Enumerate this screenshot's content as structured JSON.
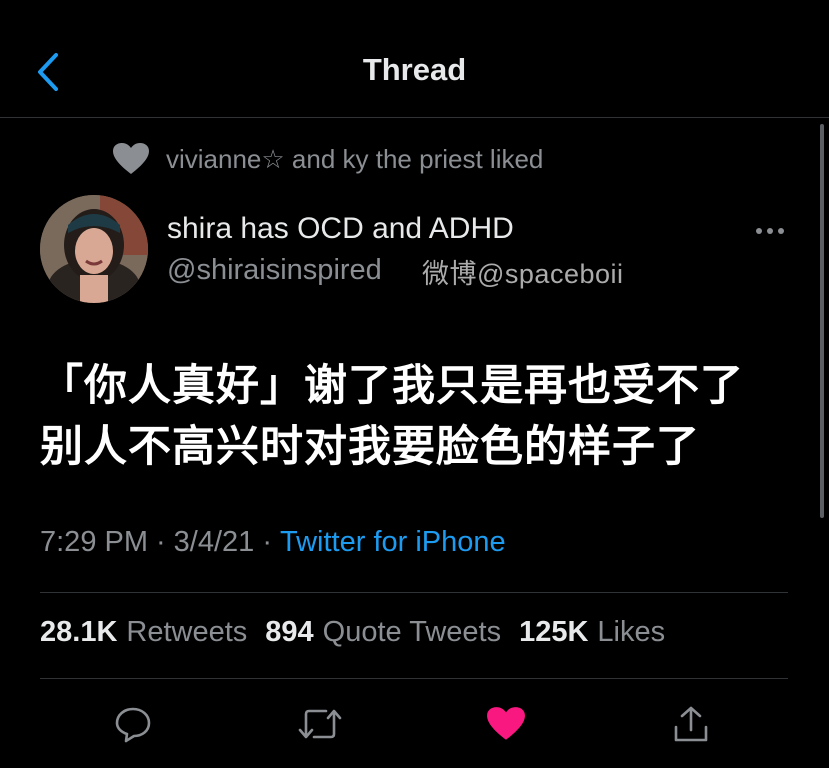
{
  "header": {
    "title": "Thread",
    "back_icon": "chevron-left-icon",
    "accent_color": "#1d9bf0"
  },
  "social_context": {
    "icon": "heart-icon",
    "text": "vivianne☆ and ky the priest liked"
  },
  "tweet": {
    "author": {
      "display_name": "shira has OCD and ADHD",
      "handle": "@shiraisinspired"
    },
    "watermark": "微博@spaceboii",
    "text_lines": [
      "「你人真好」谢了我只是再也受不了",
      "别人不高兴时对我要脸色的样子了"
    ],
    "time": "7:29 PM",
    "separator": "·",
    "date": "3/4/21",
    "source": "Twitter for iPhone"
  },
  "stats": {
    "retweets_count": "28.1K",
    "retweets_label": "Retweets",
    "quotes_count": "894",
    "quotes_label": "Quote Tweets",
    "likes_count": "125K",
    "likes_label": "Likes"
  },
  "actions": {
    "reply_icon": "reply-icon",
    "retweet_icon": "retweet-icon",
    "like_icon": "heart-icon",
    "like_color": "#f91880",
    "share_icon": "share-icon"
  }
}
